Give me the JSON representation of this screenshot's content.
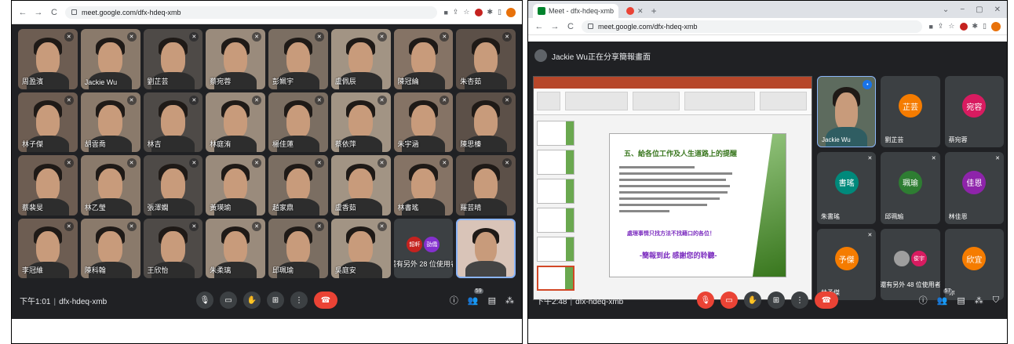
{
  "colors": {
    "meet_bg": "#202124",
    "tile_bg": "#3c4043",
    "hangup": "#ea4335",
    "accent_blue": "#8ab4f8"
  },
  "left": {
    "url": "meet.google.com/dfx-hdeq-xmb",
    "participants": [
      {
        "name": "周盈濱"
      },
      {
        "name": "Jackie Wu"
      },
      {
        "name": "劉芷芸"
      },
      {
        "name": "蔡宛蓉"
      },
      {
        "name": "彭姵宇"
      },
      {
        "name": "盧佩辰"
      },
      {
        "name": "陳冠綸"
      },
      {
        "name": "朱杏茹"
      },
      {
        "name": "林子傑"
      },
      {
        "name": "胡雲喬"
      },
      {
        "name": "林吉"
      },
      {
        "name": "林庭洧"
      },
      {
        "name": "楊佳蓮"
      },
      {
        "name": "蔡依萍"
      },
      {
        "name": "朱宇涵"
      },
      {
        "name": "陳思榛"
      },
      {
        "name": "蔡裴旻"
      },
      {
        "name": "林乙瑩"
      },
      {
        "name": "張澤嫻"
      },
      {
        "name": "黃瑛瑜"
      },
      {
        "name": "趙家鼎"
      },
      {
        "name": "盧香茹"
      },
      {
        "name": "林書瑤"
      },
      {
        "name": "羅芸晴"
      },
      {
        "name": "李冠維"
      },
      {
        "name": "陳科翰"
      },
      {
        "name": "王欣怡"
      },
      {
        "name": "朱柔璃"
      },
      {
        "name": "邱珮瑜"
      },
      {
        "name": "吳庭安"
      }
    ],
    "others": {
      "label": "還有另外 28 位使用者",
      "avatars": [
        {
          "text": "韶軒",
          "color": "#c5221f"
        },
        {
          "text": "劭僑",
          "color": "#8430ce"
        }
      ]
    },
    "time": "下午1:01",
    "meeting_code": "dfx-hdeq-xmb",
    "people_count": "59"
  },
  "right": {
    "tabs": [
      {
        "title": "Meet - dfx-hdeq-xmb"
      }
    ],
    "url": "meet.google.com/dfx-hdeq-xmb",
    "presenter_text": "Jackie Wu正在分享簡報畫面",
    "slide": {
      "title": "五、給各位工作及人生道路上的提醒",
      "emph1": "處理事情只找方法不找藉口的各位！",
      "emph2": "-簡報到此 感謝您的聆聽-"
    },
    "tiles": [
      {
        "name": "Jackie Wu",
        "avatar": "",
        "color": ""
      },
      {
        "name": "劉芷芸",
        "avatar": "芷芸",
        "color": "#f57c00"
      },
      {
        "name": "蔡宛蓉",
        "avatar": "宛容",
        "color": "#d81b60"
      },
      {
        "name": "朱書瑤",
        "avatar": "書瑤",
        "color": "#00897b"
      },
      {
        "name": "邱珮瑜",
        "avatar": "珮瑜",
        "color": "#2e7d32"
      },
      {
        "name": "林佳恩",
        "avatar": "佳恩",
        "color": "#8e24aa"
      },
      {
        "name": "林予傑",
        "avatar": "予傑",
        "color": "#f57c00"
      },
      {
        "name": "你",
        "avatar": "欣宜",
        "color": "#f57c00"
      }
    ],
    "others": {
      "label": "還有另外 48 位使用者",
      "avatars": [
        {
          "text": "",
          "color": "#9e9e9e"
        },
        {
          "text": "俊宇",
          "color": "#d81b60"
        }
      ]
    },
    "time": "下午2:48",
    "meeting_code": "dfx-hdeq-xmb",
    "people_count": "57"
  }
}
